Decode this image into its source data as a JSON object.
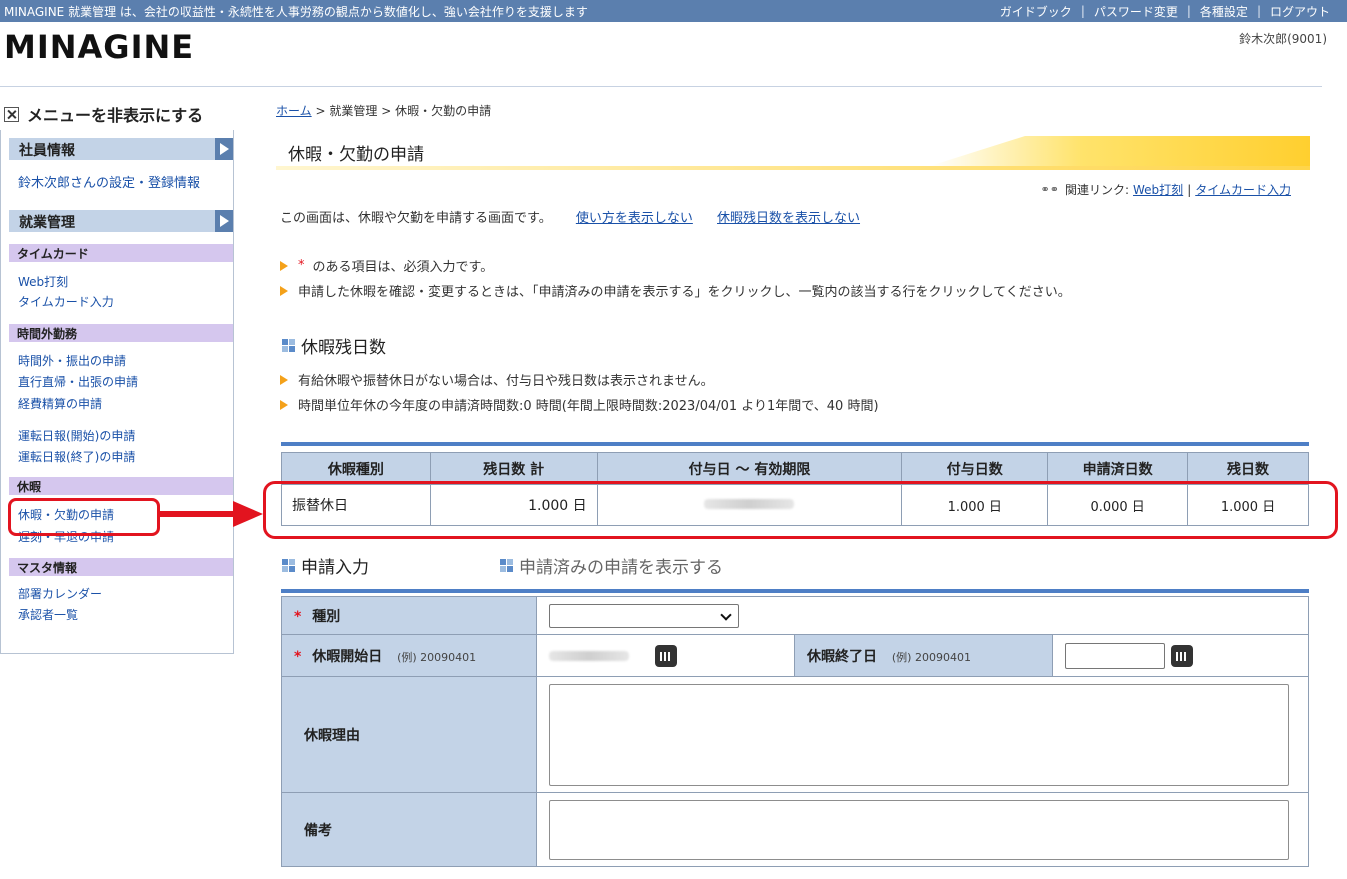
{
  "topbar": {
    "tagline": "MINAGINE 就業管理 は、会社の収益性・永続性を人事労務の観点から数値化し、強い会社作りを支援します",
    "links": [
      "ガイドブック",
      "パスワード変更",
      "各種設定",
      "ログアウト"
    ],
    "separator": "|"
  },
  "brand": {
    "logo": "MINAGINE"
  },
  "user": {
    "name": "鈴木次郎(9001)"
  },
  "sidebar": {
    "hide_menu": "メニューを非表示にする",
    "employee_info": {
      "title": "社員情報",
      "link": "鈴木次郎さんの設定・登録情報"
    },
    "work_mgmt": {
      "title": "就業管理",
      "groups": [
        {
          "title": "タイムカード",
          "items": [
            "Web打刻",
            "タイムカード入力"
          ]
        },
        {
          "title": "時間外勤務",
          "items": [
            "時間外・振出の申請",
            "直行直帰・出張の申請",
            "経費精算の申請",
            "運転日報(開始)の申請",
            "運転日報(終了)の申請"
          ]
        },
        {
          "title": "休暇",
          "items": [
            "休暇・欠勤の申請",
            "遅刻・早退の申請"
          ]
        },
        {
          "title": "マスタ情報",
          "items": [
            "部署カレンダー",
            "承認者一覧"
          ]
        }
      ]
    }
  },
  "breadcrumb": {
    "home": "ホーム",
    "sep": ">",
    "level1": "就業管理",
    "level2": "休暇・欠勤の申請"
  },
  "page": {
    "title": "休暇・欠勤の申請",
    "related_label": "関連リンク:",
    "related_links": [
      "Web打刻",
      "タイムカード入力"
    ],
    "related_sep": "|",
    "intro": "この画面は、休暇や欠勤を申請する画面です。",
    "toggle_usage": "使い方を表示しない",
    "toggle_remaining": "休暇残日数を表示しない",
    "required_star": "*",
    "bullet_required": "のある項目は、必須入力です。",
    "bullet_confirm": "申請した休暇を確認・変更するときは、「申請済みの申請を表示する」をクリックし、一覧内の該当する行をクリックしてください。"
  },
  "remaining": {
    "heading": "休暇残日数",
    "note1": "有給休暇や振替休日がない場合は、付与日や残日数は表示されません。",
    "note2": "時間単位年休の今年度の申請済時間数:0 時間(年間上限時間数:2023/04/01 より1年間で、40 時間)",
    "columns": [
      "休暇種別",
      "残日数 計",
      "付与日 〜 有効期限",
      "付与日数",
      "申請済日数",
      "残日数"
    ],
    "rows": [
      {
        "type": "振替休日",
        "total": "1.000 日",
        "granted": "1.000 日",
        "applied": "0.000 日",
        "remaining": "1.000 日"
      }
    ]
  },
  "form": {
    "heading": "申請入力",
    "show_applied": "申請済みの申請を表示する",
    "type_label": "種別",
    "start_label": "休暇開始日",
    "end_label": "休暇終了日",
    "example": "(例) 20090401",
    "reason_label": "休暇理由",
    "note_label": "備考"
  }
}
